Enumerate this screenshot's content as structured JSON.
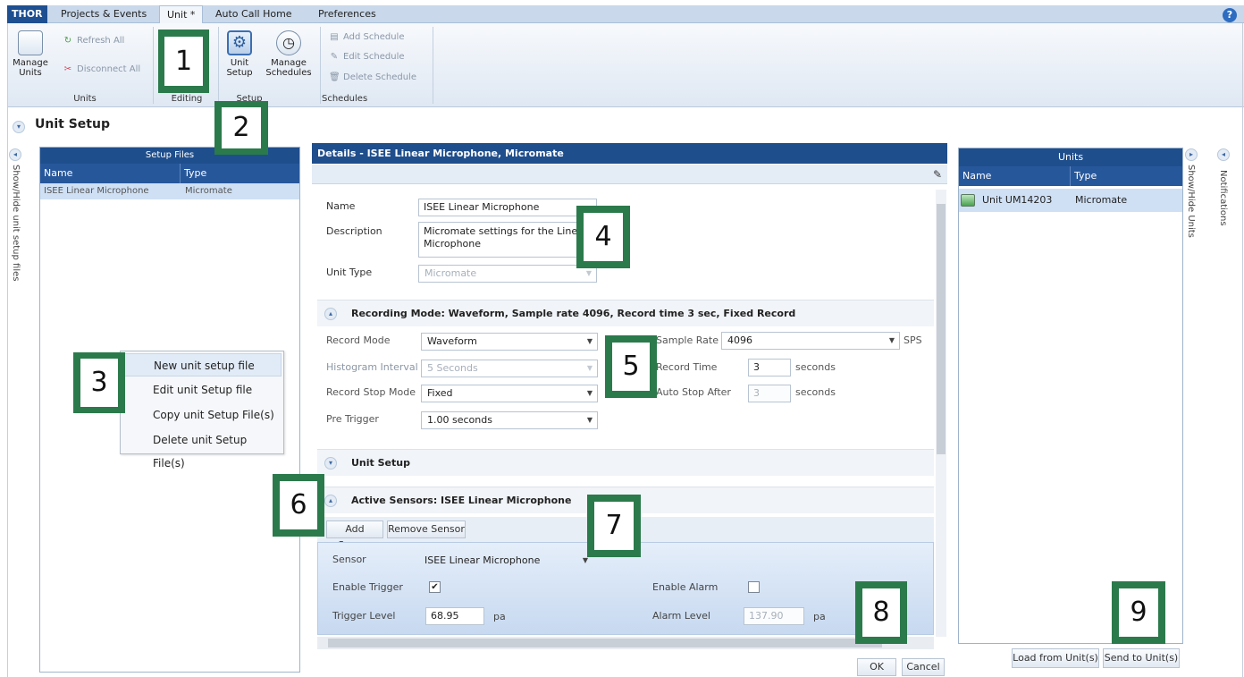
{
  "app_tab": "THOR",
  "tabs": [
    {
      "label": "Projects & Events"
    },
    {
      "label": "Unit *"
    },
    {
      "label": "Auto Call Home"
    },
    {
      "label": "Preferences"
    }
  ],
  "help_label": "?",
  "ribbon": {
    "manage_units": "Manage Units",
    "refresh_all": "Refresh All",
    "disconnect_all": "Disconnect All",
    "units_group": "Units",
    "editing_group": "Editing",
    "unit_setup": "Unit Setup",
    "manage_schedules": "Manage Schedules",
    "setup_group": "Setup",
    "add_schedule": "Add Schedule",
    "edit_schedule": "Edit Schedule",
    "delete_schedule": "Delete Schedule",
    "schedules_group": "Schedules"
  },
  "page_title": "Unit Setup",
  "left_toggle_label": "Show/Hide unit setup files",
  "setup_files": {
    "title": "Setup Files",
    "col_name": "Name",
    "col_type": "Type",
    "rows": [
      {
        "name": "ISEE Linear Microphone",
        "type": "Micromate"
      }
    ]
  },
  "context_menu": {
    "items": [
      "New unit setup file",
      "Edit unit Setup file",
      "Copy unit Setup File(s)",
      "Delete unit Setup File(s)"
    ]
  },
  "details": {
    "title": "Details - ISEE Linear Microphone, Micromate",
    "name_label": "Name",
    "name_value": "ISEE Linear Microphone",
    "description_label": "Description",
    "description_value": "Micromate settings for the Linear Microphone",
    "unit_type_label": "Unit Type",
    "unit_type_value": "Micromate",
    "recording_section": "Recording Mode:  Waveform, Sample rate 4096, Record time 3 sec, Fixed Record",
    "record_mode_label": "Record Mode",
    "record_mode_value": "Waveform",
    "histogram_label": "Histogram Interval",
    "histogram_value": "5 Seconds",
    "stop_mode_label": "Record Stop Mode",
    "stop_mode_value": "Fixed",
    "pre_trigger_label": "Pre Trigger",
    "pre_trigger_value": "1.00 seconds",
    "sample_rate_label": "Sample Rate",
    "sample_rate_value": "4096",
    "sample_rate_unit": "SPS",
    "record_time_label": "Record Time",
    "record_time_value": "3",
    "record_time_unit": "seconds",
    "auto_stop_label": "Auto Stop After",
    "auto_stop_value": "3",
    "auto_stop_unit": "seconds",
    "unit_setup_section": "Unit Setup",
    "active_sensors_section": "Active Sensors:  ISEE Linear Microphone",
    "add_sensor": "Add Sensor",
    "remove_sensor": "Remove Sensor",
    "sensor_label": "Sensor",
    "sensor_value": "ISEE Linear Microphone",
    "enable_trigger_label": "Enable Trigger",
    "enable_trigger_mark": "✔",
    "enable_alarm_label": "Enable Alarm",
    "trigger_level_label": "Trigger Level",
    "trigger_level_value": "68.95",
    "trigger_level_unit": "pa",
    "alarm_level_label": "Alarm Level",
    "alarm_level_value": "137.90",
    "alarm_level_unit": "pa",
    "ok": "OK",
    "cancel": "Cancel"
  },
  "units": {
    "title": "Units",
    "col_name": "Name",
    "col_type": "Type",
    "rows": [
      {
        "name": "Unit UM14203",
        "type": "Micromate"
      }
    ],
    "load": "Load from Unit(s)",
    "send": "Send to Unit(s)",
    "toggle_label": "Show/Hide Units"
  },
  "notifications_label": "Notifications",
  "markers": [
    "1",
    "2",
    "3",
    "4",
    "5",
    "6",
    "7",
    "8",
    "9"
  ]
}
